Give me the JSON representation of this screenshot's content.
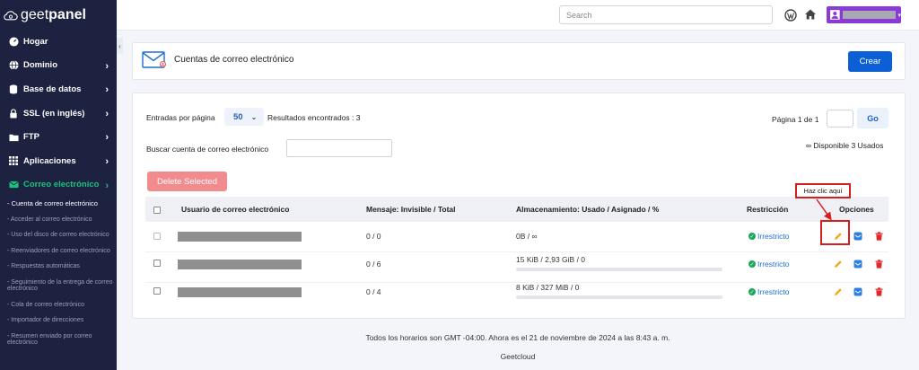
{
  "brand": {
    "part1": "geet",
    "part2": "panel"
  },
  "sidebar": {
    "items": [
      {
        "label": "Hogar",
        "icon": "speedometer-icon"
      },
      {
        "label": "Dominio",
        "icon": "globe-icon"
      },
      {
        "label": "Base de datos",
        "icon": "database-icon"
      },
      {
        "label": "SSL (en inglés)",
        "icon": "lock-icon"
      },
      {
        "label": "FTP",
        "icon": "folder-icon"
      },
      {
        "label": "Aplicaciones",
        "icon": "grid-icon"
      },
      {
        "label": "Correo electrónico",
        "icon": "envelope-icon"
      }
    ],
    "subitems": [
      "- Cuenta de correo electrónico",
      "- Acceder al correo electrónico",
      "- Uso del disco de correo electrónico",
      "- Reenviadores de correo electrónico",
      "- Respuestas automáticas",
      "- Seguimiento de la entrega de correo electrónico",
      "- Cola de correo electrónico",
      "- Importador de direcciones",
      "- Resumen enviado por correo electrónico"
    ]
  },
  "topbar": {
    "search_placeholder": "Search"
  },
  "header": {
    "title": "Cuentas de correo electrónico",
    "create_label": "Crear"
  },
  "controls": {
    "entries_label": "Entradas por página",
    "per_page": "50",
    "results_label": "Resultados encontrados : 3",
    "page_label": "Página 1 de 1",
    "go_label": "Go",
    "search_label": "Buscar cuenta de correo electrónico",
    "available_label": "∞ Disponible 3 Usados",
    "delete_label": "Delete Selected"
  },
  "table": {
    "headers": {
      "user": "Usuario de correo electrónico",
      "messages": "Mensaje: Invisible / Total",
      "storage": "Almacenamiento: Usado / Asignado / %",
      "restriction": "Restricción",
      "options": "Opciones"
    },
    "rows": [
      {
        "messages": "0 / 0",
        "storage": "0B / ∞",
        "status": "Irrestricto",
        "bar": false
      },
      {
        "messages": "0 / 6",
        "storage": "15 KiB / 2,93 GiB / 0",
        "status": "Irrestricto",
        "bar": true
      },
      {
        "messages": "0 / 4",
        "storage": "8 KiB / 327 MiB / 0",
        "status": "Irrestricto",
        "bar": true
      }
    ]
  },
  "callout": "Haz clic aquí",
  "footer": {
    "timezone": "Todos los horarios son GMT -04:00. Ahora es el 21 de noviembre de 2024 a las 8:43 a. m.",
    "company": "Geetcloud"
  },
  "colors": {
    "sidebar": "#1c2240",
    "accent_green": "#19c37d",
    "primary": "#0d5fd6",
    "user_button": "#8a3ad6",
    "delete": "#f28b8d",
    "highlight": "#d61e1e"
  }
}
